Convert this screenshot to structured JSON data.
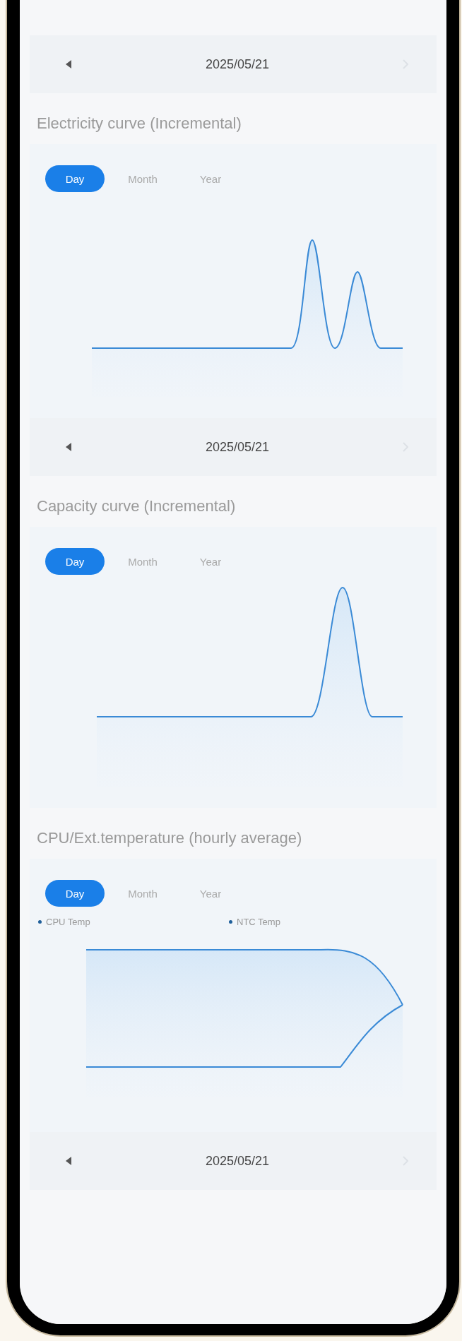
{
  "sections": [
    {
      "kind": "date_bar",
      "date": "2025/05/21"
    },
    {
      "kind": "chart",
      "title": "Electricity curve (Incremental)",
      "tabs": [
        {
          "label": "Day",
          "selected": true
        },
        {
          "label": "Month",
          "selected": false
        },
        {
          "label": "Year",
          "selected": false
        }
      ]
    },
    {
      "kind": "date_bar",
      "date": "2025/05/21"
    },
    {
      "kind": "chart",
      "title": "Capacity curve (Incremental)",
      "tabs": [
        {
          "label": "Day",
          "selected": true
        },
        {
          "label": "Month",
          "selected": false
        },
        {
          "label": "Year",
          "selected": false
        }
      ]
    },
    {
      "kind": "chart",
      "title": "CPU/Ext.temperature (hourly average)",
      "tabs": [
        {
          "label": "Day",
          "selected": true
        },
        {
          "label": "Month",
          "selected": false
        },
        {
          "label": "Year",
          "selected": false
        }
      ],
      "legend": [
        "CPU Temp",
        "NTC Temp"
      ]
    },
    {
      "kind": "date_bar",
      "date": "2025/05/21"
    }
  ]
}
